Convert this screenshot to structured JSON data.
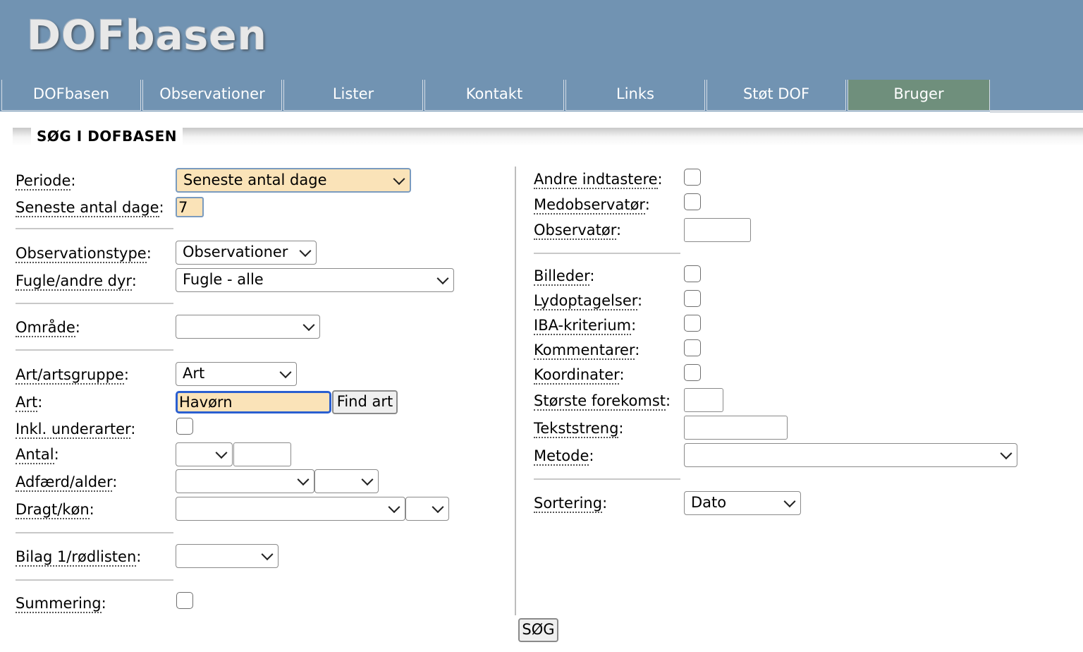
{
  "header": {
    "logo": "DOFbasen"
  },
  "nav": [
    {
      "label": "DOFbasen"
    },
    {
      "label": "Observationer"
    },
    {
      "label": "Lister"
    },
    {
      "label": "Kontakt"
    },
    {
      "label": "Links"
    },
    {
      "label": "Støt DOF"
    },
    {
      "label": "Bruger",
      "active": true
    }
  ],
  "section": {
    "title": "SØG I DOFBASEN"
  },
  "left": {
    "periode": {
      "label": "Periode",
      "value": "Seneste antal dage"
    },
    "seneste": {
      "label": "Seneste antal dage",
      "value": "7"
    },
    "obstype": {
      "label": "Observationstype",
      "value": "Observationer"
    },
    "fugle": {
      "label": "Fugle/andre dyr",
      "value": "Fugle - alle"
    },
    "omrade": {
      "label": "Område",
      "value": ""
    },
    "artsgruppe": {
      "label": "Art/artsgruppe",
      "value": "Art"
    },
    "art": {
      "label": "Art",
      "value": "Havørn",
      "button": "Find art"
    },
    "underarter": {
      "label": "Inkl. underarter"
    },
    "antal": {
      "label": "Antal"
    },
    "adfaerd": {
      "label": "Adfærd/alder"
    },
    "dragt": {
      "label": "Dragt/køn"
    },
    "bilag": {
      "label": "Bilag 1/rødlisten"
    },
    "summering": {
      "label": "Summering"
    }
  },
  "right": {
    "andre": {
      "label": "Andre indtastere"
    },
    "medobs": {
      "label": "Medobservatør"
    },
    "observator": {
      "label": "Observatør"
    },
    "billeder": {
      "label": "Billeder"
    },
    "lyd": {
      "label": "Lydoptagelser"
    },
    "iba": {
      "label": "IBA-kriterium"
    },
    "kommentarer": {
      "label": "Kommentarer"
    },
    "koordinater": {
      "label": "Koordinater"
    },
    "storste": {
      "label": "Største forekomst"
    },
    "tekst": {
      "label": "Tekststreng"
    },
    "metode": {
      "label": "Metode",
      "value": ""
    },
    "sortering": {
      "label": "Sortering",
      "value": "Dato"
    }
  },
  "submit": {
    "label": "SØG"
  },
  "colon": ":",
  "colors": {
    "header": "#7193b2",
    "active_tab": "#6f8f7c",
    "highlight": "#fae3b8",
    "focus": "#2a5fd0"
  }
}
